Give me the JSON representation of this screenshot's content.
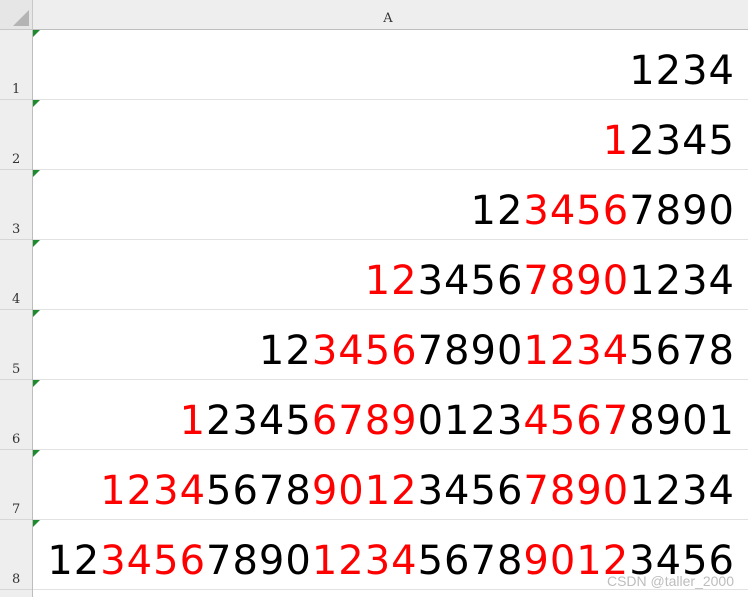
{
  "sheet": {
    "column_header": "A",
    "rows": [
      {
        "row_number": "1",
        "segments": [
          {
            "text": "1234",
            "color": "black"
          }
        ]
      },
      {
        "row_number": "2",
        "segments": [
          {
            "text": "1",
            "color": "red"
          },
          {
            "text": "2345",
            "color": "black"
          }
        ]
      },
      {
        "row_number": "3",
        "segments": [
          {
            "text": "12",
            "color": "black"
          },
          {
            "text": "3456",
            "color": "red"
          },
          {
            "text": "7890",
            "color": "black"
          }
        ]
      },
      {
        "row_number": "4",
        "segments": [
          {
            "text": "12",
            "color": "red"
          },
          {
            "text": "3456",
            "color": "black"
          },
          {
            "text": "7890",
            "color": "red"
          },
          {
            "text": "1234",
            "color": "black"
          }
        ]
      },
      {
        "row_number": "5",
        "segments": [
          {
            "text": "12",
            "color": "black"
          },
          {
            "text": "3456",
            "color": "red"
          },
          {
            "text": "7890",
            "color": "black"
          },
          {
            "text": "1234",
            "color": "red"
          },
          {
            "text": "5678",
            "color": "black"
          }
        ]
      },
      {
        "row_number": "6",
        "segments": [
          {
            "text": "1",
            "color": "red"
          },
          {
            "text": "2345",
            "color": "black"
          },
          {
            "text": "6789",
            "color": "red"
          },
          {
            "text": "0123",
            "color": "black"
          },
          {
            "text": "4567",
            "color": "red"
          },
          {
            "text": "8901",
            "color": "black"
          }
        ]
      },
      {
        "row_number": "7",
        "segments": [
          {
            "text": "1234",
            "color": "red"
          },
          {
            "text": "5678",
            "color": "black"
          },
          {
            "text": "9012",
            "color": "red"
          },
          {
            "text": "3456",
            "color": "black"
          },
          {
            "text": "7890",
            "color": "red"
          },
          {
            "text": "1234",
            "color": "black"
          }
        ]
      },
      {
        "row_number": "8",
        "segments": [
          {
            "text": "12",
            "color": "black"
          },
          {
            "text": "3456",
            "color": "red"
          },
          {
            "text": "7890",
            "color": "black"
          },
          {
            "text": "1234",
            "color": "red"
          },
          {
            "text": "5678",
            "color": "black"
          },
          {
            "text": "9012",
            "color": "red"
          },
          {
            "text": "3456",
            "color": "black"
          }
        ]
      }
    ]
  },
  "watermark": "CSDN @taller_2000",
  "colors": {
    "red": "#ff0000",
    "black": "#000000",
    "text_indicator": "#1e8a2e",
    "header_bg": "#eeeeee"
  },
  "icons": {
    "select_all": "select-all-triangle",
    "text_format_marker": "green-corner-triangle"
  }
}
